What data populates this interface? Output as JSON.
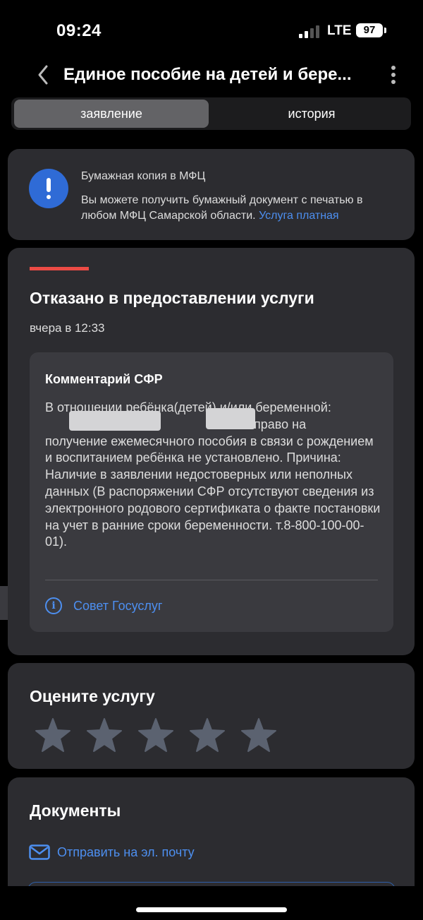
{
  "status_bar": {
    "time": "09:24",
    "network": "LTE",
    "battery": "97"
  },
  "nav": {
    "title": "Единое пособие на детей и бере..."
  },
  "tabs": [
    {
      "label": "заявление",
      "active": true
    },
    {
      "label": "история",
      "active": false
    }
  ],
  "notice": {
    "title": "Бумажная копия в МФЦ",
    "text": "Вы можете получить бумажный документ с печатью в любом МФЦ Самарской области. ",
    "link": "Услуга платная"
  },
  "result": {
    "title": "Отказано в предоставлении услуги",
    "date": "вчера в 12:33",
    "comment_title": "Комментарий СФР",
    "comment_line1": "В отношении ребёнка(детей) и/или беременной:",
    "comment_line2": "право на",
    "comment_rest": "получение ежемесячного пособия в связи с рождением и воспитанием ребёнка не установлено. Причина: Наличие в заявлении недостоверных или неполных данных (В распоряжении СФР отсутствуют сведения из электронного родового сертификата о факте постановки на учет в ранние сроки беременности. т.8-800-100-00-01).",
    "tip_label": "Совет Госуслуг"
  },
  "rating": {
    "title": "Оцените услугу",
    "stars": 0,
    "max_stars": 5
  },
  "documents": {
    "title": "Документы",
    "email_label": "Отправить на эл. почту"
  },
  "colors": {
    "accent": "#4d8ff0",
    "alert": "#ec4b45",
    "card": "#2c2c30",
    "notice_icon": "#2f6bd6"
  }
}
